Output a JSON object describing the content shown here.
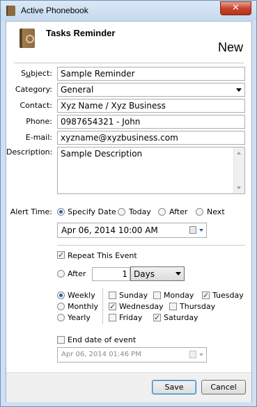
{
  "window": {
    "title": "Active Phonebook",
    "close_glyph": "✕"
  },
  "header": {
    "title": "Tasks Reminder",
    "mode": "New",
    "icon": "address-book-icon"
  },
  "form": {
    "subject": {
      "label": "Subject:",
      "value": "Sample Reminder"
    },
    "category": {
      "label": "Category:",
      "value": "General"
    },
    "contact": {
      "label": "Contact:",
      "value": "Xyz Name / Xyz Business"
    },
    "phone": {
      "label": "Phone:",
      "value": "0987654321 - John"
    },
    "email": {
      "label": "E-mail:",
      "value": "xyzname@xyzbusiness.com"
    },
    "description": {
      "label": "Description:",
      "value": "Sample Description"
    }
  },
  "alert": {
    "label": "Alert Time:",
    "options": [
      "Specify Date",
      "Today",
      "After",
      "Next"
    ],
    "selected": "Specify Date",
    "datetime": "Apr  06, 2014 10:00 AM"
  },
  "repeat": {
    "label": "Repeat This Event",
    "checked": true,
    "after_label": "After",
    "after_value": "1",
    "unit": "Days",
    "frequency": [
      "Weekly",
      "Monthly",
      "Yearly"
    ],
    "frequency_selected": "Weekly",
    "days": [
      {
        "name": "Sunday",
        "checked": false
      },
      {
        "name": "Monday",
        "checked": false
      },
      {
        "name": "Tuesday",
        "checked": true
      },
      {
        "name": "Wednesday",
        "checked": true
      },
      {
        "name": "Thursday",
        "checked": false
      },
      {
        "name": "Friday",
        "checked": false
      },
      {
        "name": "Saturday",
        "checked": true
      }
    ]
  },
  "end_date": {
    "label": "End date of event",
    "checked": false,
    "value": "Apr  06, 2014 01:46 PM"
  },
  "buttons": {
    "save": "Save",
    "cancel": "Cancel"
  }
}
